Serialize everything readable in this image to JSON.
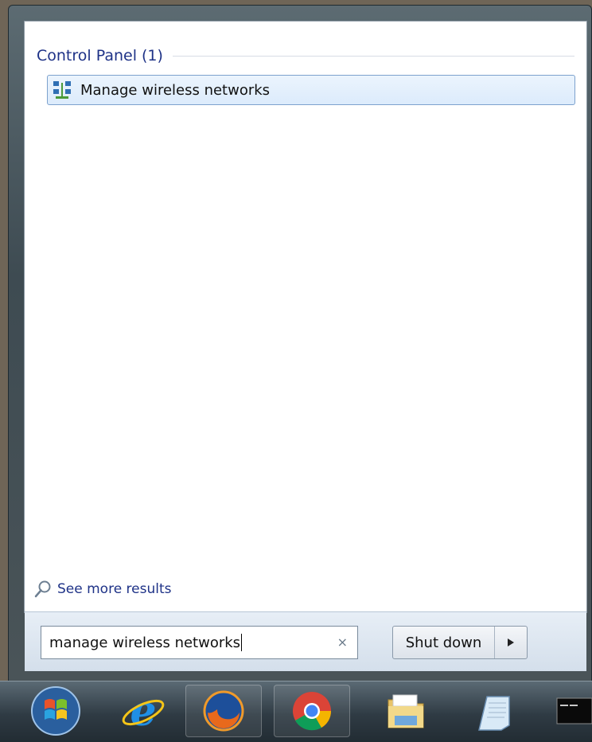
{
  "start_menu": {
    "group_title": "Control Panel (1)",
    "results": [
      {
        "label": "Manage wireless networks",
        "icon": "network-icon"
      }
    ],
    "see_more": {
      "label": "See more results",
      "icon": "search-icon"
    },
    "search": {
      "value": "manage wireless networks",
      "clear_glyph": "×"
    },
    "shutdown": {
      "label": "Shut down",
      "arrow_icon": "chevron-right-icon"
    }
  },
  "taskbar": {
    "items": [
      {
        "name": "start-orb-icon"
      },
      {
        "name": "internet-explorer-icon"
      },
      {
        "name": "firefox-icon"
      },
      {
        "name": "chrome-icon"
      },
      {
        "name": "windows-explorer-icon"
      },
      {
        "name": "notepad-icon"
      },
      {
        "name": "command-prompt-icon"
      }
    ]
  },
  "colors": {
    "header_text": "#1e3287",
    "selection_border": "#7da2ce",
    "selection_fill": "#dcebfc"
  }
}
